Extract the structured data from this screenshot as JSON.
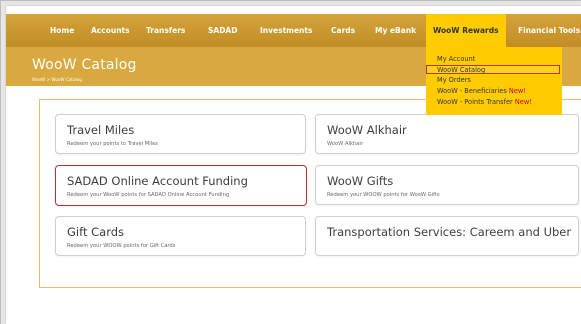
{
  "nav": {
    "items": [
      {
        "label": "Home"
      },
      {
        "label": "Accounts"
      },
      {
        "label": "Transfers"
      },
      {
        "label": "SADAD"
      },
      {
        "label": "Investments"
      },
      {
        "label": "Cards"
      },
      {
        "label": "My eBank"
      },
      {
        "label": "WooW Rewards"
      },
      {
        "label": "Financial Tools"
      }
    ]
  },
  "header": {
    "title": "WooW Catalog",
    "breadcrumb": "WooW > WooW Catalog"
  },
  "dropdown": {
    "items": [
      {
        "label": "My Account",
        "badge": ""
      },
      {
        "label": "WooW Catalog",
        "badge": ""
      },
      {
        "label": "My Orders",
        "badge": ""
      },
      {
        "label": "WooW - Beneficiaries",
        "badge": "New!"
      },
      {
        "label": "WooW - Points Transfer",
        "badge": "New!"
      }
    ]
  },
  "cards": [
    {
      "title": "Travel Miles",
      "desc": "Redeem your points to Travel Miles"
    },
    {
      "title": "WooW Alkhair",
      "desc": "WooW Alkhair"
    },
    {
      "title": "SADAD Online Account Funding",
      "desc": "Redeem your WooW points for SADAD Online Account Funding"
    },
    {
      "title": "WooW Gifts",
      "desc": "Redeem your WOOW points for WooW Gifts"
    },
    {
      "title": "Gift Cards",
      "desc": "Redeem your WOOW points for Gift Cards"
    },
    {
      "title": "Transportation Services: Careem and Uber",
      "desc": ""
    }
  ],
  "colors": {
    "nav_bg": "#c9962d",
    "header_band": "#d9a83f",
    "dropdown_bg": "#ffcc00",
    "highlight_border": "#c0302b",
    "new_badge": "#d0021b"
  }
}
